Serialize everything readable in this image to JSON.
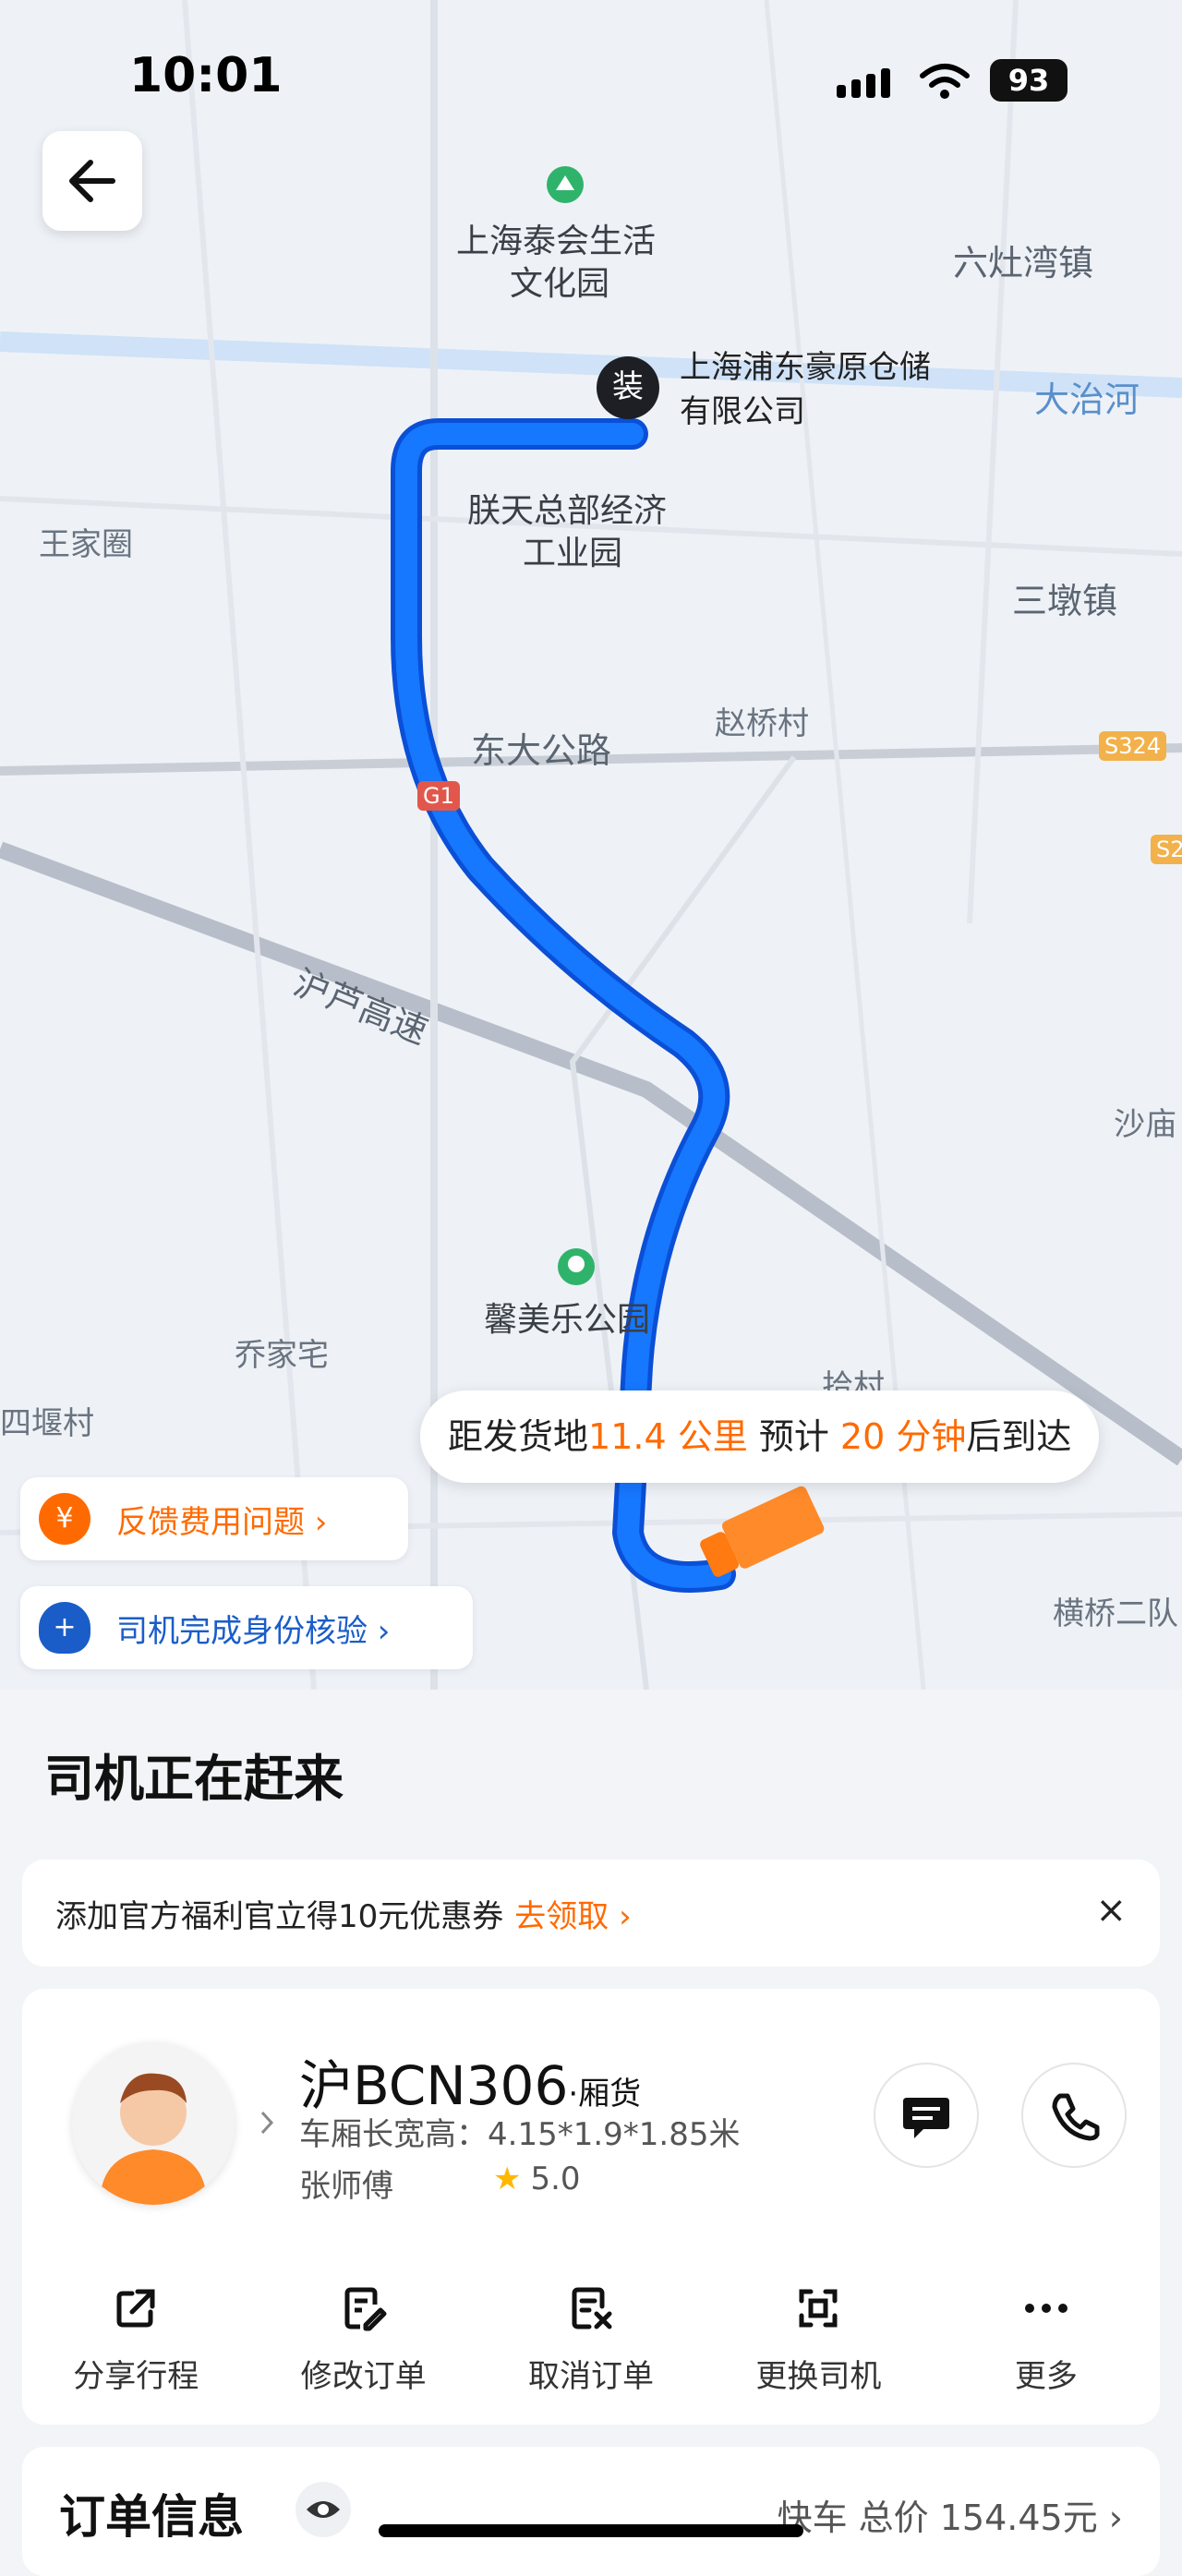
{
  "status_bar": {
    "time": "10:01",
    "battery": "93"
  },
  "map": {
    "places": [
      "上海泰会生活",
      "文化园",
      "六灶湾镇",
      "大治河",
      "王家圈",
      "朕天总部经济",
      "工业园",
      "三墩镇",
      "东大公路",
      "赵桥村",
      "S324",
      "S2",
      "G1",
      "沪芦高速",
      "沙庙",
      "馨美乐公园",
      "乔家宅",
      "四堰村",
      "拾村",
      "横桥二队"
    ],
    "pickup_pin": "装",
    "pickup_name_line1": "上海浦东豪原仓储",
    "pickup_name_line2": "有限公司",
    "eta": {
      "prefix": "距发货地",
      "distance": "11.4 公里",
      "middle": "预计",
      "time": "20 分钟",
      "suffix": "后到达"
    },
    "chips": [
      {
        "icon": "¥",
        "label": "反馈费用问题 ›"
      },
      {
        "icon": "+",
        "label": "司机完成身份核验 ›"
      }
    ]
  },
  "panel": {
    "title": "司机正在赶来",
    "promo": {
      "text": "添加官方福利官立得10元优惠券",
      "link": "去领取 ›",
      "close": "×"
    },
    "driver": {
      "plate": "沪BCN306",
      "truck_type": "·厢货",
      "spec": "车厢长宽高：4.15*1.9*1.85米",
      "name": "张师傅",
      "rating": "5.0"
    },
    "actions": [
      "分享行程",
      "修改订单",
      "取消订单",
      "更换司机",
      "更多"
    ],
    "order": {
      "title": "订单信息",
      "summary": "快车 总价 154.45元 ›"
    }
  },
  "colors": {
    "route": "#1677ff",
    "accent": "#ff6a00",
    "verify": "#1a5dc8"
  }
}
